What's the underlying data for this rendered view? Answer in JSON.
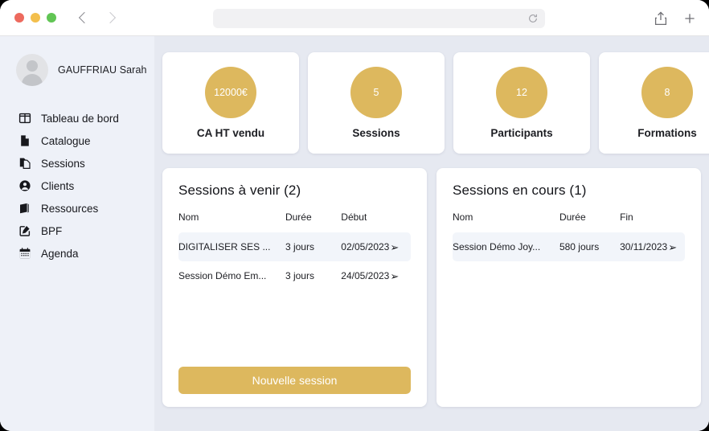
{
  "browser": {
    "traffic_lights": [
      "close",
      "minimize",
      "zoom"
    ],
    "back_label": "Back",
    "forward_label": "Forward",
    "url_value": "",
    "url_placeholder": "",
    "reload_label": "Reload",
    "share_label": "Share",
    "new_tab_label": "New Tab"
  },
  "sidebar": {
    "user": {
      "name": "GAUFFRIAU Sarah",
      "avatar": "person-avatar"
    },
    "items": [
      {
        "label": "Tableau de bord",
        "icon": "dashboard-icon"
      },
      {
        "label": "Catalogue",
        "icon": "document-icon"
      },
      {
        "label": "Sessions",
        "icon": "copy-documents-icon"
      },
      {
        "label": "Clients",
        "icon": "user-circle-icon"
      },
      {
        "label": "Ressources",
        "icon": "book-icon"
      },
      {
        "label": "BPF",
        "icon": "pencil-square-icon"
      },
      {
        "label": "Agenda",
        "icon": "calendar-icon"
      }
    ]
  },
  "theme": {
    "accent": "#ddb85e",
    "sidebar_bg": "#eef1f8",
    "content_bg": "#e6e9f1",
    "card_bg": "#ffffff",
    "row_highlight": "#f2f5fa"
  },
  "stats": [
    {
      "value": "12000€",
      "label": "CA HT vendu"
    },
    {
      "value": "5",
      "label": "Sessions"
    },
    {
      "value": "12",
      "label": "Participants"
    },
    {
      "value": "8",
      "label": "Formations"
    }
  ],
  "upcoming": {
    "title": "Sessions à venir (2)",
    "columns": [
      "Nom",
      "Durée",
      "Début"
    ],
    "rows": [
      {
        "name": "DIGITALISER SES ...",
        "duree": "3 jours",
        "date": "02/05/2023",
        "arrow": "arrow-right-icon",
        "highlighted": true
      },
      {
        "name": "Session Démo Em...",
        "duree": "3 jours",
        "date": "24/05/2023",
        "arrow": "arrow-right-icon",
        "highlighted": false
      }
    ],
    "button_label": "Nouvelle session"
  },
  "ongoing": {
    "title": "Sessions en cours (1)",
    "columns": [
      "Nom",
      "Durée",
      "Fin"
    ],
    "rows": [
      {
        "name": "Session Démo Joy...",
        "duree": "580 jours",
        "date": "30/11/2023",
        "arrow": "arrow-right-icon",
        "highlighted": true
      }
    ]
  }
}
